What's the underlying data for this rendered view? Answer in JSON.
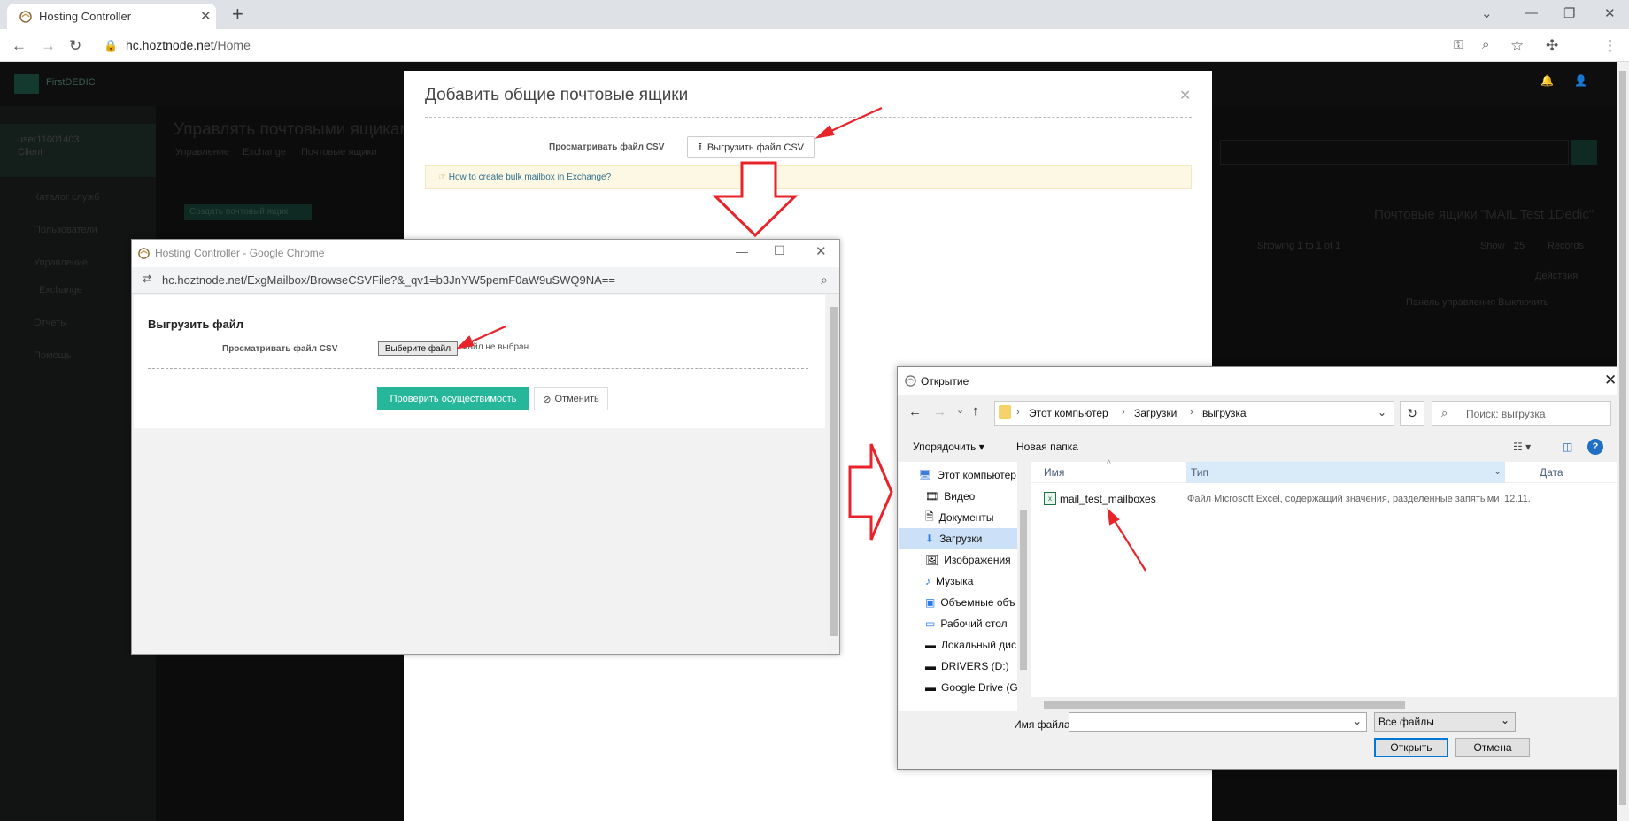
{
  "browser": {
    "tab_title": "Hosting Controller",
    "url_host": "hc.hoztnode.net",
    "url_path": "/Home"
  },
  "background": {
    "brand": "FirstDEDIC",
    "user_name": "user11001403",
    "user_role": "Client",
    "page_title": "Управлять почтовыми ящиками",
    "breadcrumb": [
      "Управление",
      "Exchange",
      "Почтовые ящики"
    ],
    "create_button": "Создать почтовый ящик",
    "sidebar_items": [
      "Каталог служб",
      "Пользователи",
      "Управление",
      "Exchange",
      "Отчеты",
      "Помощь"
    ],
    "right_heading": "Почтовые ящики \"MAIL Test 1Dedic\"",
    "showing": "Showing 1 to 1 of 1",
    "show_label": "Show",
    "show_value": "25",
    "records_label": "Records",
    "actions_header": "Действия",
    "row_action": "Панель управления   Выключить"
  },
  "modal": {
    "title": "Добавить общие почтовые ящики",
    "browse_label": "Просматривать файл CSV",
    "upload_button": "Выгрузить файл CSV",
    "info_link": "How to create bulk mailbox in Exchange?"
  },
  "popup": {
    "window_title": "Hosting Controller - Google Chrome",
    "url": "hc.hoztnode.net/ExgMailbox/BrowseCSVFile?&_qv1=b3JnYW5pemF0aW9uSWQ9NA==",
    "heading": "Выгрузить файл",
    "browse_label": "Просматривать файл CSV",
    "choose_button": "Выберите файл",
    "no_file": "Файл не выбран",
    "check_button": "Проверить осуществимость",
    "cancel_button": "Отменить"
  },
  "dialog": {
    "title": "Открытие",
    "path": [
      "Этот компьютер",
      "Загрузки",
      "выгрузка"
    ],
    "search_placeholder": "Поиск: выгрузка",
    "organize": "Упорядочить",
    "new_folder": "Новая папка",
    "nav_items": [
      "Этот компьютер",
      "Видео",
      "Документы",
      "Загрузки",
      "Изображения",
      "Музыка",
      "Объемные объ",
      "Рабочий стол",
      "Локальный дис",
      "DRIVERS (D:)",
      "Google Drive (G:"
    ],
    "col_name": "Имя",
    "col_type": "Тип",
    "col_date": "Дата",
    "file_name": "mail_test_mailboxes",
    "file_type": "Файл Microsoft Excel, содержащий значения, разделенные запятыми",
    "file_date": "12.11.",
    "filename_label": "Имя файла:",
    "filetype": "Все файлы",
    "open_button": "Открыть",
    "cancel_button": "Отмена"
  },
  "colors": {
    "accent_green": "#26b69a",
    "annotation_red": "#e8232a"
  }
}
